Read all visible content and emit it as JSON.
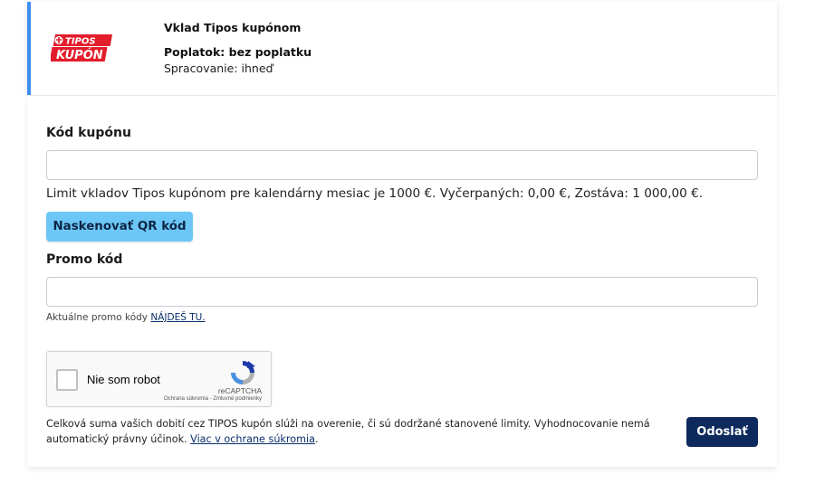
{
  "header": {
    "logo_top": "TIPOS",
    "logo_bottom": "KUPÓN",
    "title": "Vklad Tipos kupónom",
    "fee": "Poplatok: bez poplatku",
    "processing": "Spracovanie: ihneď"
  },
  "form": {
    "coupon_label": "Kód kupónu",
    "coupon_value": "",
    "limit_text": "Limit vkladov Tipos kupónom pre kalendárny mesiac je 1000 €. Vyčerpaných: 0,00 €, Zostáva: 1 000,00 €.",
    "scan_button": "Naskenovať QR kód",
    "promo_label": "Promo kód",
    "promo_value": "",
    "promo_hint_prefix": "Aktuálne promo kódy",
    "promo_hint_link": "NÁJDEŠ TU."
  },
  "captcha": {
    "label": "Nie som robot",
    "brand": "reCAPTCHA",
    "terms": "Ochrana súkromia - Zmluvné podmienky",
    "icon": "recaptcha-icon"
  },
  "footer": {
    "note_text": "Celková suma vašich dobití cez TIPOS kupón slúži na overenie, či sú dodržané stanovené limity. Vyhodnocovanie nemá automatický právny účinok.",
    "note_link": "Viac v ochrane súkromia",
    "note_end": ".",
    "submit_label": "Odoslať"
  },
  "colors": {
    "accent_border": "#3d8ff0",
    "scan_button": "#6cc7f7",
    "submit_button": "#0e2a5c",
    "logo_red": "#e31d2b"
  }
}
